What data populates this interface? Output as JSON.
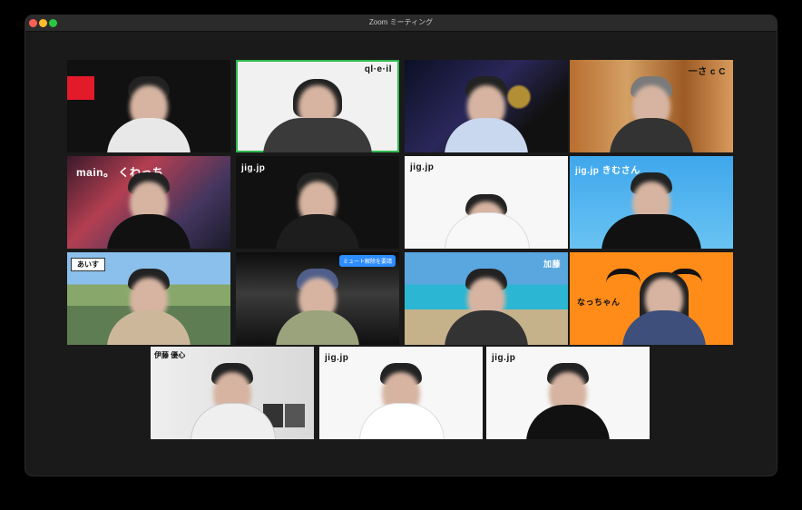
{
  "window": {
    "title": "Zoom ミーティング"
  },
  "tiles": [
    {
      "name": "tile-1",
      "label": "",
      "unmute": ""
    },
    {
      "name": "tile-2",
      "label": "ql·e·il",
      "unmute": ""
    },
    {
      "name": "tile-3",
      "label": "",
      "unmute": ""
    },
    {
      "name": "tile-4",
      "label": "一さ c C",
      "unmute": ""
    },
    {
      "name": "tile-5",
      "label": "main。 くわっち",
      "unmute": ""
    },
    {
      "name": "tile-6",
      "label": "jig.jp",
      "unmute": ""
    },
    {
      "name": "tile-7",
      "label": "jig.jp",
      "unmute": ""
    },
    {
      "name": "tile-8",
      "label": "jig.jp きむさん",
      "unmute": ""
    },
    {
      "name": "tile-9",
      "label": "あいす",
      "unmute": ""
    },
    {
      "name": "tile-10",
      "label": "",
      "unmute": "ミュート解除を要請"
    },
    {
      "name": "tile-11",
      "label": "加藤",
      "unmute": ""
    },
    {
      "name": "tile-12",
      "label": "なっちゃん",
      "unmute": ""
    },
    {
      "name": "tile-13",
      "label": "伊藤 優心",
      "unmute": ""
    },
    {
      "name": "tile-14",
      "label": "jig.jp",
      "unmute": ""
    },
    {
      "name": "tile-15",
      "label": "jig.jp",
      "unmute": ""
    }
  ]
}
